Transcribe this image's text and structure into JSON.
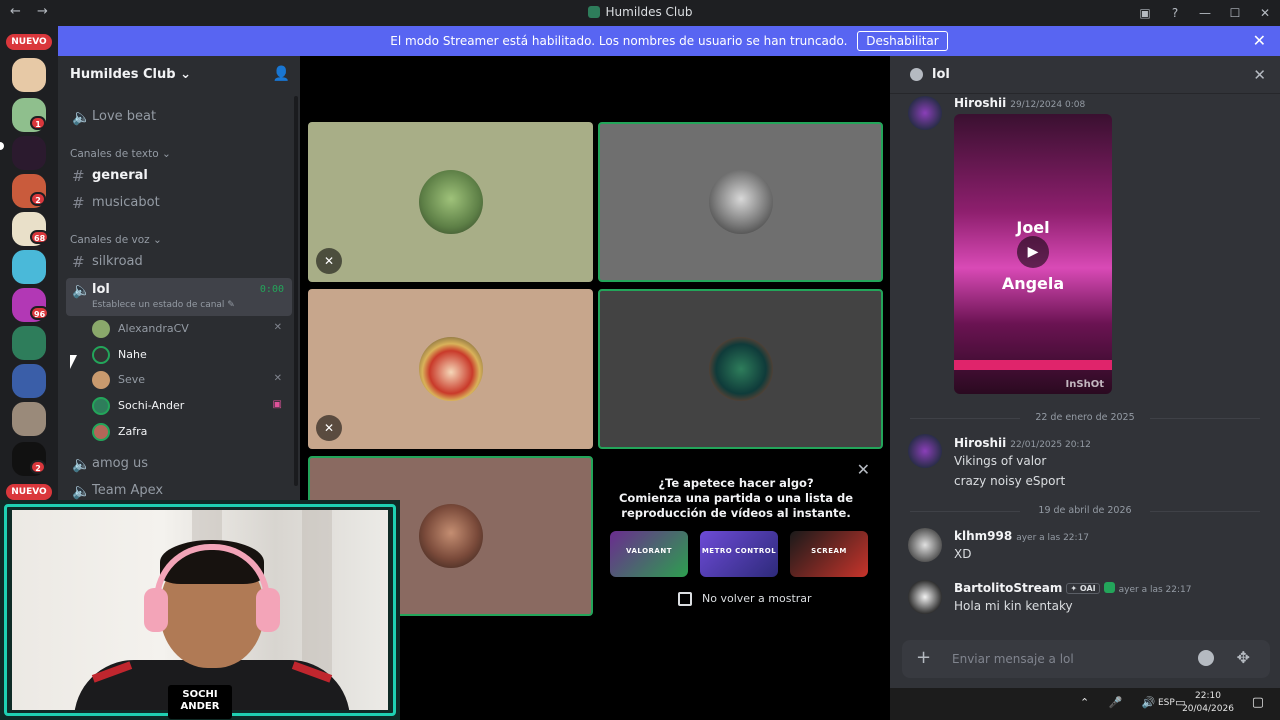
{
  "window": {
    "title": "Humildes Club",
    "nav_glyphs": "← →",
    "controls": [
      "▣",
      "?",
      "—",
      "☐",
      "✕"
    ]
  },
  "banner": {
    "text": "El modo Streamer está habilitado. Los nombres de usuario se han truncado.",
    "button": "Deshabilitar",
    "close": "✕"
  },
  "rail": {
    "new_label_top": "NUEVO",
    "new_label_bottom": "NUEVO",
    "badges": [
      "1",
      "2",
      "68",
      "96",
      "2"
    ]
  },
  "sidebar": {
    "server_name": "Humildes Club",
    "server_chevron": "⌄",
    "invite_icon": "👤",
    "voice_top": "Love beat",
    "text_category": "Canales de texto",
    "text_channels": [
      "general",
      "musicabot"
    ],
    "voice_category": "Canales de voz",
    "voice_channels": [
      "silkroad",
      "lol",
      "amog us",
      "Team Apex"
    ],
    "active_timer": "0:00",
    "active_status": "Establece un estado de canal ✎",
    "voice_users": [
      {
        "name": "AlexandraCV",
        "status": "✕"
      },
      {
        "name": "Nahe",
        "status": ""
      },
      {
        "name": "Seve",
        "status": "✕"
      },
      {
        "name": "Sochi-Ander",
        "status": "▣"
      },
      {
        "name": "Zafra",
        "status": ""
      }
    ]
  },
  "stage": {
    "mute_glyph": "✕",
    "activity": {
      "title": "¿Te apetece hacer algo?",
      "line2": "Comienza una partida o una lista de",
      "line3": "reproducción de vídeos al instante.",
      "cards": [
        "VALORANT",
        "METRO CONTROL",
        "SCREAM"
      ],
      "checkbox_label": "No volver a mostrar",
      "close": "✕"
    }
  },
  "chat": {
    "channel": "lol",
    "close": "✕",
    "messages": [
      {
        "author": "Hiroshii",
        "time": "29/12/2024 0:08"
      },
      {
        "author": "Hiroshii",
        "time": "22/01/2025 20:12",
        "lines": [
          "Vikings of valor",
          "crazy noisy eSport"
        ]
      },
      {
        "author": "klhm998",
        "time": "ayer a las 22:17",
        "lines": [
          "XD"
        ]
      },
      {
        "author": "BartolitoStream",
        "tag": "✦ OAI",
        "time": "ayer a las 22:17",
        "lines": [
          "Hola mi kin kentaky"
        ]
      }
    ],
    "video": {
      "word1": "Joel",
      "word2": "Angela",
      "watermark": "InShOt",
      "play": "▶"
    },
    "dividers": [
      "22 de enero de 2025",
      "19 de abril de 2026"
    ],
    "composer": {
      "placeholder": "Enviar mensaje a lol",
      "plus": "+",
      "apps": "✥"
    }
  },
  "webcam": {
    "logo_line1": "SOCHI",
    "logo_line2": "ANDER"
  },
  "taskbar": {
    "tray": "⌃ 🎤 🔊 ▭",
    "lang": "ESP",
    "time": "22:10",
    "date": "20/04/2026",
    "notif": "▢"
  },
  "colors": {
    "accent": "#5865f2",
    "speaking": "#23a55a",
    "danger": "#da373c",
    "webcam_frame": "#1fd1b2"
  }
}
